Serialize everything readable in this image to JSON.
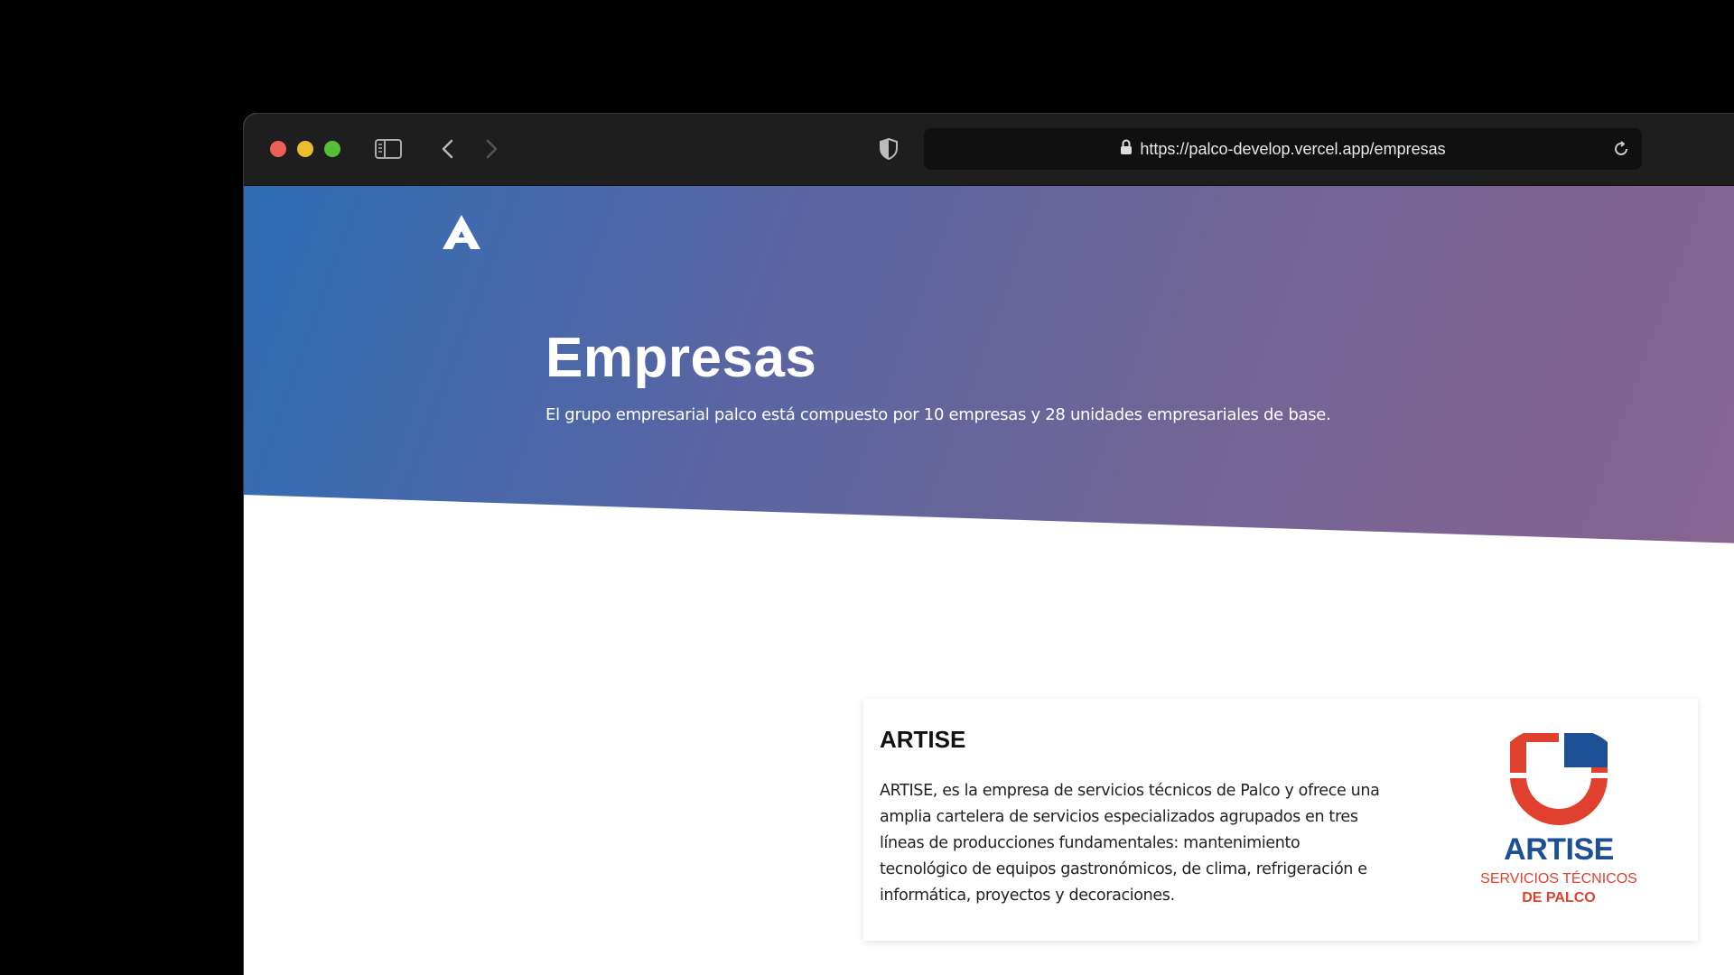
{
  "browser": {
    "url": "https://palco-develop.vercel.app/empresas",
    "icons": [
      "sidebar-icon",
      "chevron-left-icon",
      "chevron-right-icon",
      "shield-icon",
      "lock-icon",
      "reload-icon"
    ]
  },
  "hero": {
    "title": "Empresas",
    "subtitle": "El grupo empresarial palco está compuesto por 10 empresas y 28 unidades empresariales de base.",
    "gradient_colors": [
      "#2e6db5",
      "#8a6491"
    ]
  },
  "company_card": {
    "title": "ARTISE",
    "description": "ARTISE, es la empresa de servicios técnicos de Palco y ofrece una amplia cartelera de servicios especializados agrupados en tres líneas de producciones fundamentales: mantenimiento tecnológico de equipos gastronómicos, de clima, refrigeración e informática, proyectos y decoraciones.",
    "logo": {
      "name": "ARTISE",
      "tagline_1": "SERVICIOS TÉCNICOS",
      "tagline_2": "DE PALCO",
      "colors": {
        "blue": "#1d4f95",
        "red": "#e0402e"
      }
    }
  }
}
